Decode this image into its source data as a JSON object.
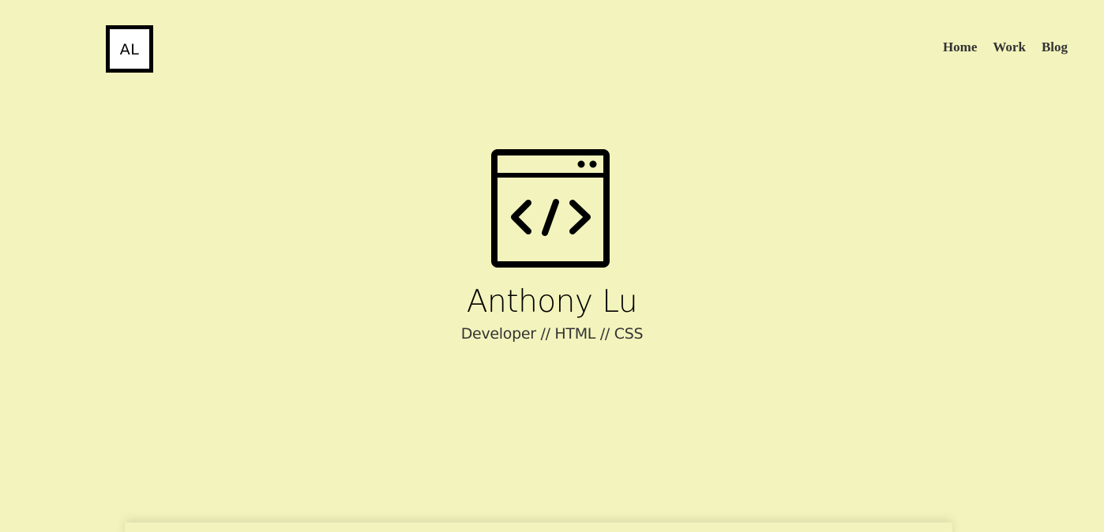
{
  "logo": {
    "text": "AL"
  },
  "nav": {
    "items": [
      {
        "label": "Home"
      },
      {
        "label": "Work"
      },
      {
        "label": "Blog"
      }
    ]
  },
  "hero": {
    "icon": "code-window-icon",
    "name": "Anthony Lu",
    "tagline": "Developer // HTML // CSS"
  },
  "colors": {
    "background": "#f3f4bd",
    "nav_text": "#333333",
    "icon": "#000000"
  }
}
